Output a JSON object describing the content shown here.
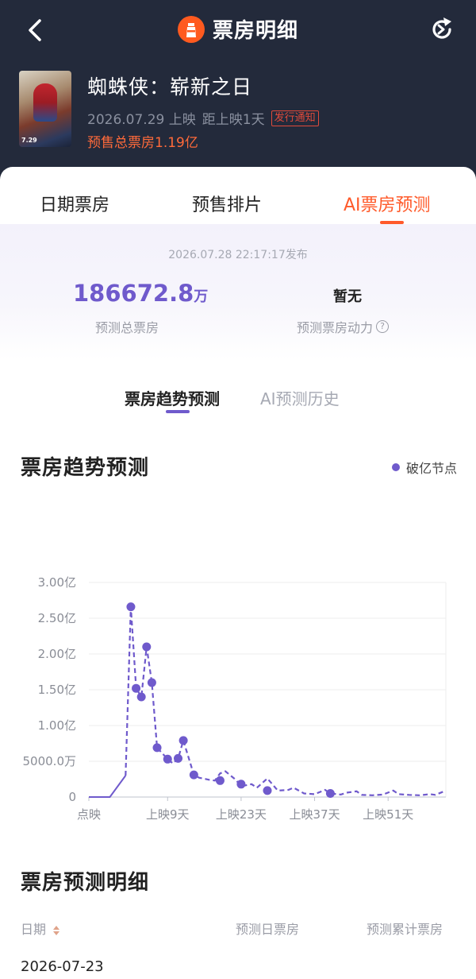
{
  "header": {
    "title": "票房明细",
    "movie": {
      "name": "蜘蛛侠：崭新之日",
      "release": "2026.07.29 上映",
      "countdown": "距上映1天",
      "notice_badge": "发行通知",
      "presale": "预售总票房1.19亿"
    }
  },
  "tabs": [
    "日期票房",
    "预售排片",
    "AI票房预测"
  ],
  "summary": {
    "publish_time": "2026.07.28 22:17:17发布",
    "total_value": "186672.8",
    "total_unit": "万",
    "total_label": "预测总票房",
    "momentum_value": "暂无",
    "momentum_label": "预测票房动力",
    "help_glyph": "?"
  },
  "subtabs": [
    "票房趋势预测",
    "AI预测历史"
  ],
  "trend": {
    "title": "票房趋势预测",
    "legend": "破亿节点"
  },
  "chart_data": {
    "type": "line",
    "title": "票房趋势预测",
    "ylim": [
      0,
      30000
    ],
    "y_ticks": [
      0,
      5000,
      10000,
      15000,
      20000,
      25000,
      30000
    ],
    "y_tick_labels": [
      "0",
      "5000.0万",
      "1.00亿",
      "1.50亿",
      "2.00亿",
      "2.50亿",
      "3.00亿"
    ],
    "x_tick_labels": [
      "点映",
      "上映9天",
      "上映23天",
      "上映37天",
      "上映51天"
    ],
    "x_tick_days": [
      -6,
      9,
      23,
      37,
      51
    ],
    "xlim": [
      -6,
      62
    ],
    "grid": true,
    "series": [
      {
        "name": "破亿节点",
        "unit": "万",
        "x": [
          -6,
          -2,
          1,
          2,
          3,
          4,
          5,
          6,
          7,
          9,
          10,
          11,
          12,
          14,
          15,
          17,
          18,
          19,
          20,
          22,
          23,
          25,
          26,
          28,
          30,
          32,
          33,
          35,
          37,
          39,
          40,
          42,
          43,
          45,
          46,
          48,
          50,
          52,
          53,
          55,
          57,
          59,
          60,
          62
        ],
        "values": [
          0,
          0,
          3000,
          26600,
          15200,
          14000,
          21000,
          16000,
          6900,
          5300,
          4700,
          5400,
          7900,
          3100,
          2700,
          2400,
          2300,
          3300,
          3600,
          2400,
          1500,
          1800,
          1300,
          2600,
          900,
          1000,
          1300,
          500,
          400,
          1000,
          500,
          350,
          600,
          800,
          300,
          250,
          350,
          900,
          400,
          300,
          250,
          400,
          300,
          900
        ],
        "markers_x": [
          2,
          3,
          4,
          5,
          6,
          7,
          9,
          11,
          12,
          14,
          19,
          23,
          28,
          40
        ],
        "markers": [
          26600,
          15200,
          14000,
          21000,
          16000,
          6900,
          5300,
          5400,
          7900,
          3100,
          2300,
          1800,
          900,
          500
        ]
      }
    ]
  },
  "detail": {
    "title": "票房预测明细",
    "col_date": "日期",
    "col_daily": "预测日票房",
    "col_total": "预测累计票房",
    "first_row_date": "2026-07-23"
  },
  "colors": {
    "header_bg": "#232a3b",
    "accent": "#ff5a2a",
    "series": "#6f5acc"
  }
}
